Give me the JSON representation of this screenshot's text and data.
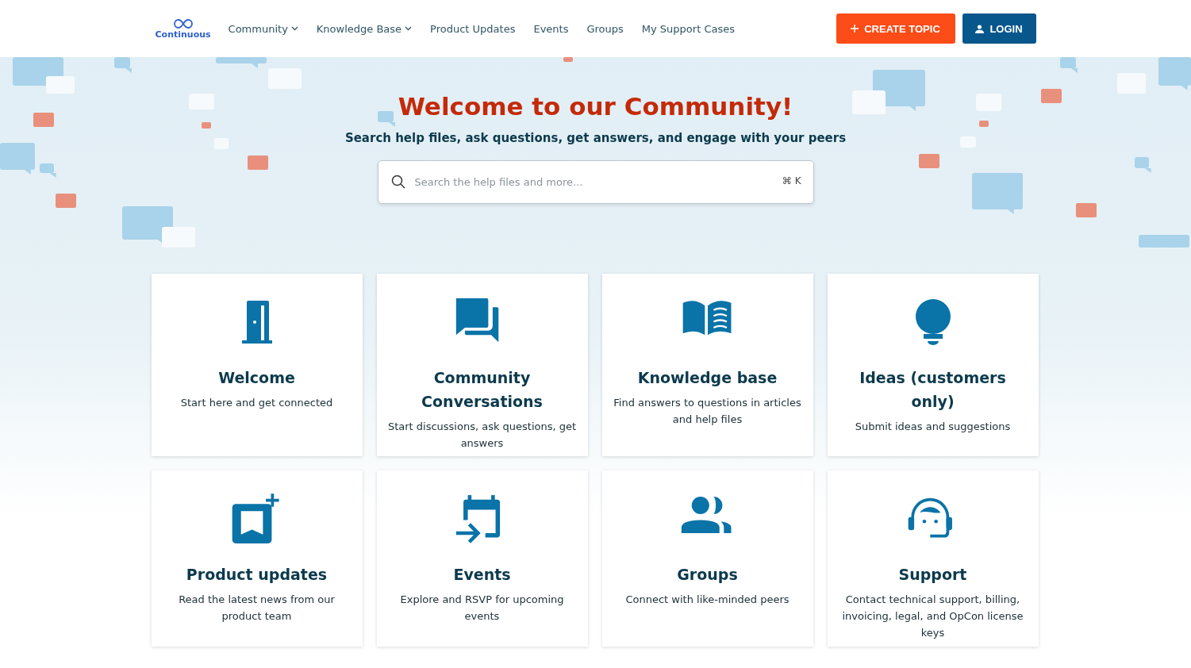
{
  "header": {
    "logo": "Continuous",
    "nav": [
      {
        "label": "Community",
        "dropdown": true
      },
      {
        "label": "Knowledge Base",
        "dropdown": true
      },
      {
        "label": "Product Updates",
        "dropdown": false
      },
      {
        "label": "Events",
        "dropdown": false
      },
      {
        "label": "Groups",
        "dropdown": false
      },
      {
        "label": "My Support Cases",
        "dropdown": false
      }
    ],
    "create_button": "CREATE TOPIC",
    "login_button": "LOGIN"
  },
  "hero": {
    "title": "Welcome to our Community!",
    "subtitle": "Search help files, ask questions, get answers, and engage with your peers",
    "search": {
      "placeholder": "Search the help files and more...",
      "shortcut": "⌘ K"
    }
  },
  "cards": [
    {
      "kind": "door",
      "title": "Welcome",
      "description": "Start here and get connected"
    },
    {
      "kind": "chat",
      "title": "Community Conversations",
      "description": "Start discussions, ask questions, get answers"
    },
    {
      "kind": "book",
      "title": "Knowledge base",
      "description": "Find answers to questions in articles and help files"
    },
    {
      "kind": "bulb",
      "title": "Ideas (customers only)",
      "description": "Submit ideas and suggestions"
    },
    {
      "kind": "updates",
      "title": "Product updates",
      "description": "Read the latest news from our product team"
    },
    {
      "kind": "calendar",
      "title": "Events",
      "description": "Explore and RSVP for upcoming events"
    },
    {
      "kind": "people",
      "title": "Groups",
      "description": "Connect with like-minded peers"
    },
    {
      "kind": "headset",
      "title": "Support",
      "description": "Contact technical support, billing, invoicing, legal, and OpCon license keys"
    }
  ]
}
